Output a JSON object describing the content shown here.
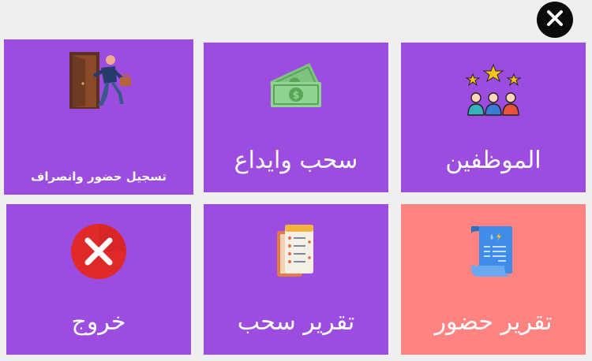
{
  "colors": {
    "tile_purple": "#9c4ddf",
    "tile_pink": "#ff8380",
    "background": "#efefef",
    "close_bg": "#0b0b0b"
  },
  "tiles": {
    "attendance": {
      "label": "تسجيل حضور وانصراف",
      "icon": "exit-door-icon"
    },
    "cash": {
      "label": "سحب وايداع",
      "icon": "money-icon"
    },
    "employees": {
      "label": "الموظفين",
      "icon": "employees-stars-icon"
    },
    "exit": {
      "label": "خروج",
      "icon": "cancel-icon"
    },
    "withdraw_report": {
      "label": "تقرير سحب",
      "icon": "receipts-icon"
    },
    "attendance_report": {
      "label": "تقرير حضور",
      "icon": "document-icon"
    }
  },
  "close": {
    "icon": "close-icon"
  }
}
